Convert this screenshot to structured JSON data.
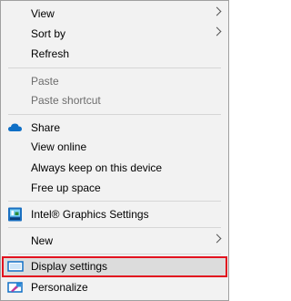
{
  "menu": {
    "view": "View",
    "sort_by": "Sort by",
    "refresh": "Refresh",
    "paste": "Paste",
    "paste_shortcut": "Paste shortcut",
    "share": "Share",
    "view_online": "View online",
    "always_keep": "Always keep on this device",
    "free_up_space": "Free up space",
    "intel_graphics": "Intel® Graphics Settings",
    "new": "New",
    "display_settings": "Display settings",
    "personalize": "Personalize"
  },
  "icons": {
    "share": "cloud-icon",
    "intel_graphics": "intel-graphics-icon",
    "display_settings": "monitor-icon",
    "personalize": "personalize-icon"
  },
  "colors": {
    "highlight_border": "#e2121f",
    "accent_blue": "#0f6fc6"
  }
}
